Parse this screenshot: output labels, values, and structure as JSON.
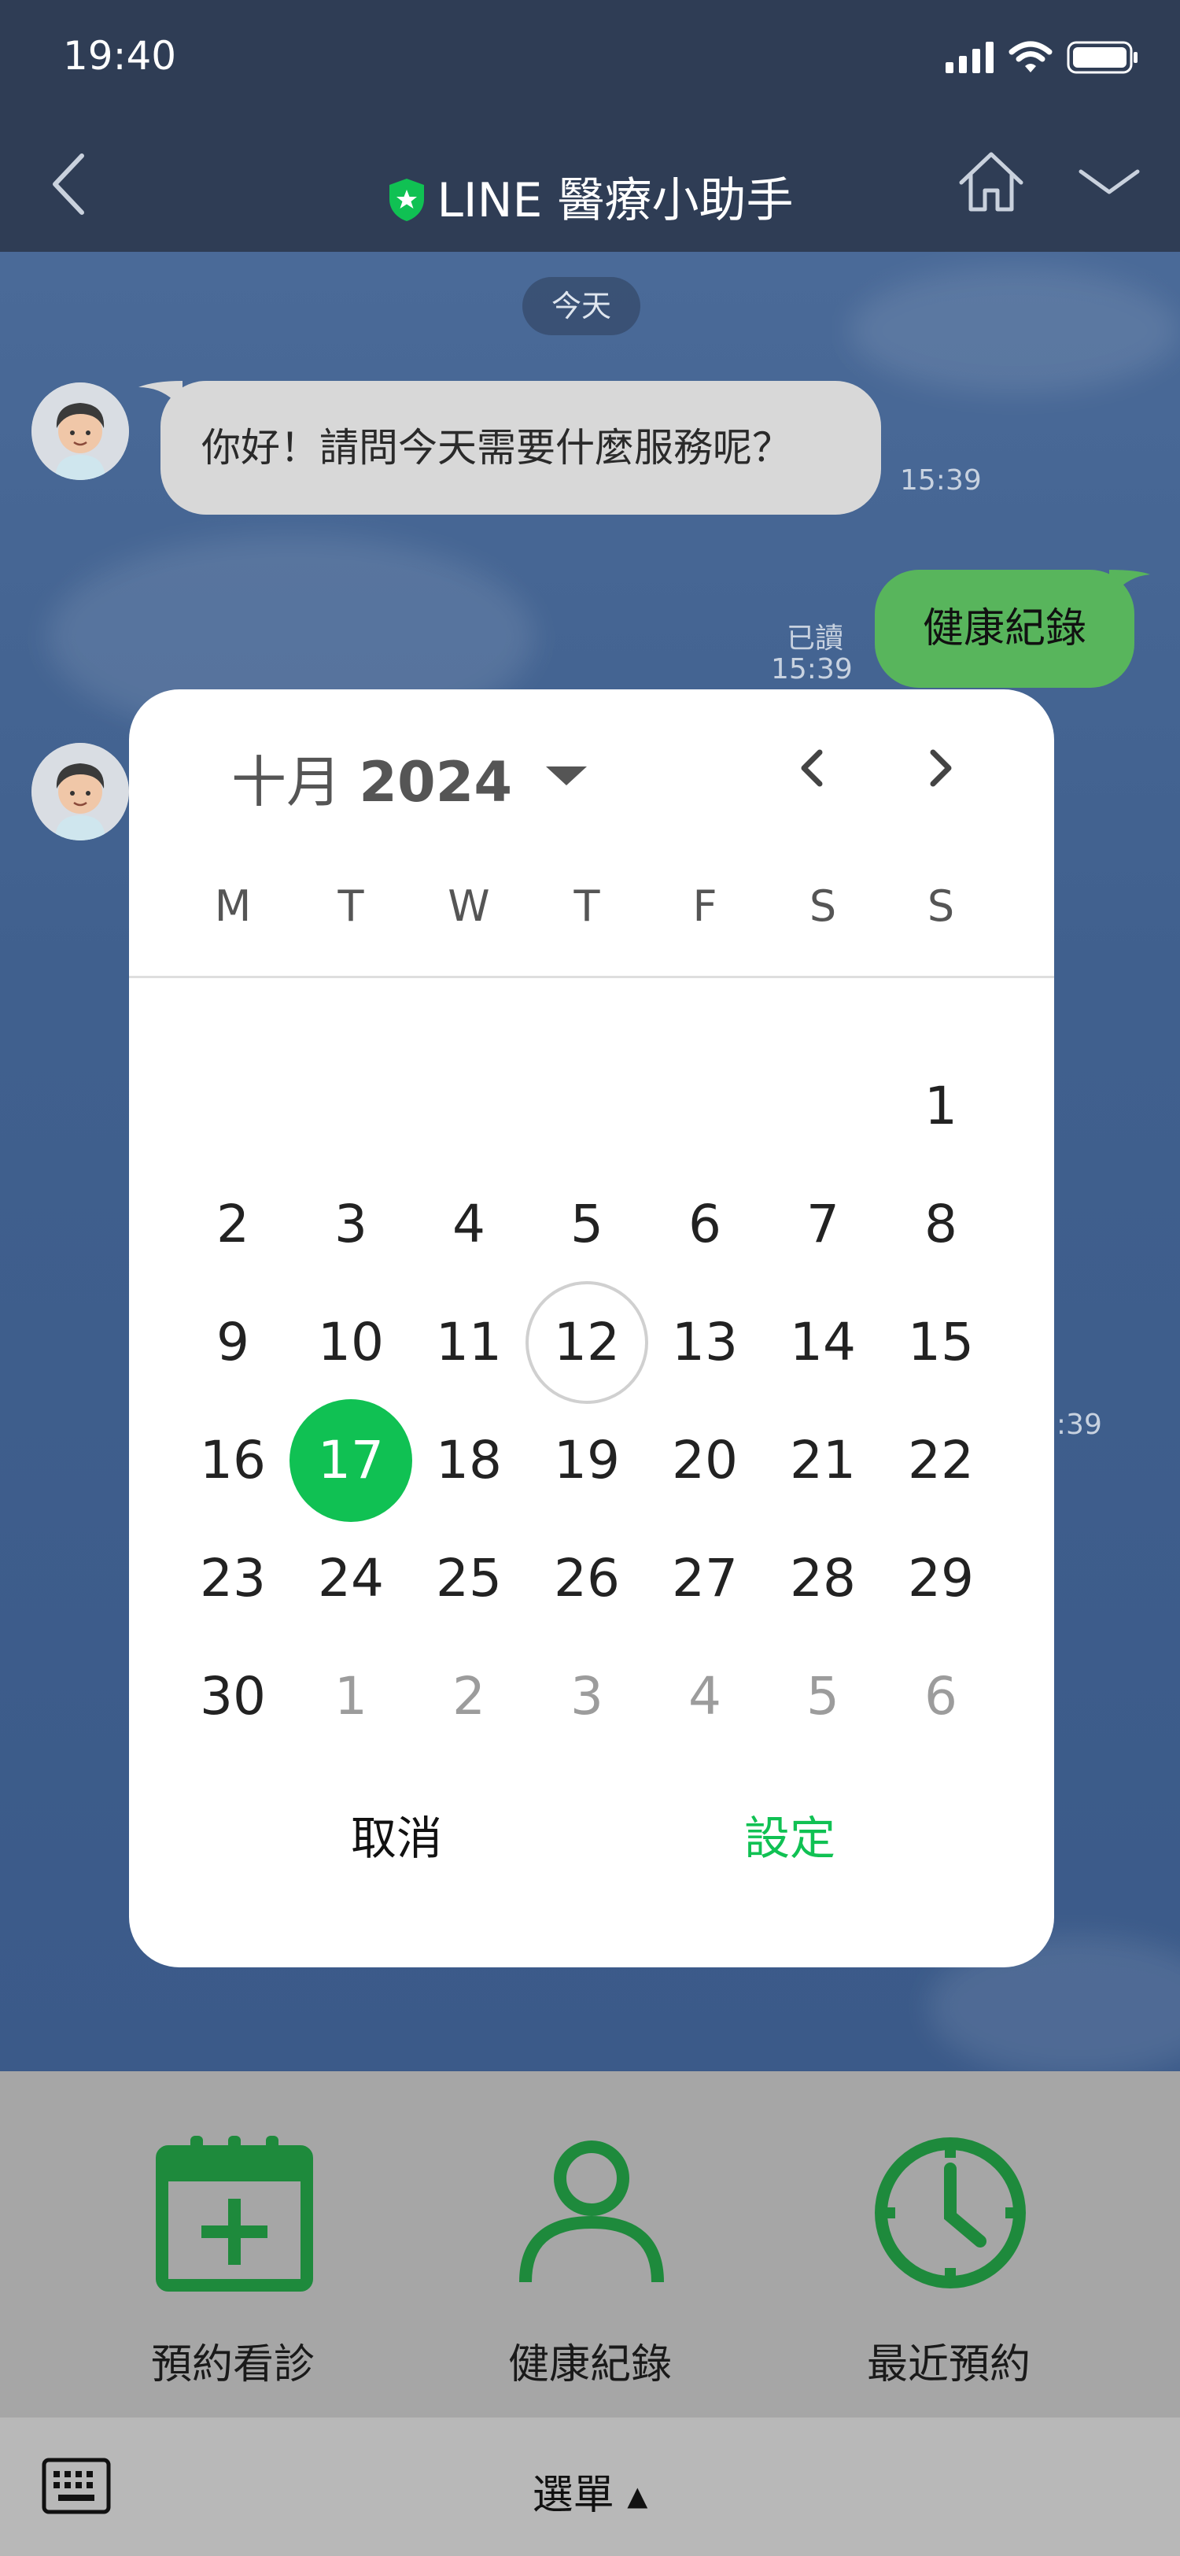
{
  "status_bar": {
    "time": "19:40"
  },
  "header": {
    "title": "LINE 醫療小助手"
  },
  "chat": {
    "date_label": "今天",
    "messages": [
      {
        "sender": "bot",
        "text": "你好！請問今天需要什麼服務呢？",
        "time": "15:39"
      },
      {
        "sender": "user",
        "text": "健康紀錄",
        "read_label": "已讀",
        "time": "15:39"
      },
      {
        "sender": "bot",
        "partial_time": "5:39"
      }
    ]
  },
  "date_picker": {
    "month_label": "十月",
    "year_label": "2024",
    "weekdays": [
      "M",
      "T",
      "W",
      "T",
      "F",
      "S",
      "S"
    ],
    "days": [
      "1",
      "2",
      "3",
      "4",
      "5",
      "6",
      "7",
      "8",
      "9",
      "10",
      "11",
      "12",
      "13",
      "14",
      "15",
      "16",
      "17",
      "18",
      "19",
      "20",
      "21",
      "22",
      "23",
      "24",
      "25",
      "26",
      "27",
      "28",
      "29",
      "30",
      "1",
      "2",
      "3",
      "4",
      "5",
      "6"
    ],
    "today": "12",
    "selected": "17",
    "cancel_label": "取消",
    "set_label": "設定",
    "accent_color": "#10c153"
  },
  "rich_menu": {
    "items": [
      {
        "label": "預約看診",
        "icon": "calendar-add-icon"
      },
      {
        "label": "健康紀錄",
        "icon": "person-icon"
      },
      {
        "label": "最近預約",
        "icon": "clock-icon"
      }
    ],
    "icon_color": "#1e8a3c"
  },
  "bottom_bar": {
    "menu_label": "選單 ▴"
  }
}
